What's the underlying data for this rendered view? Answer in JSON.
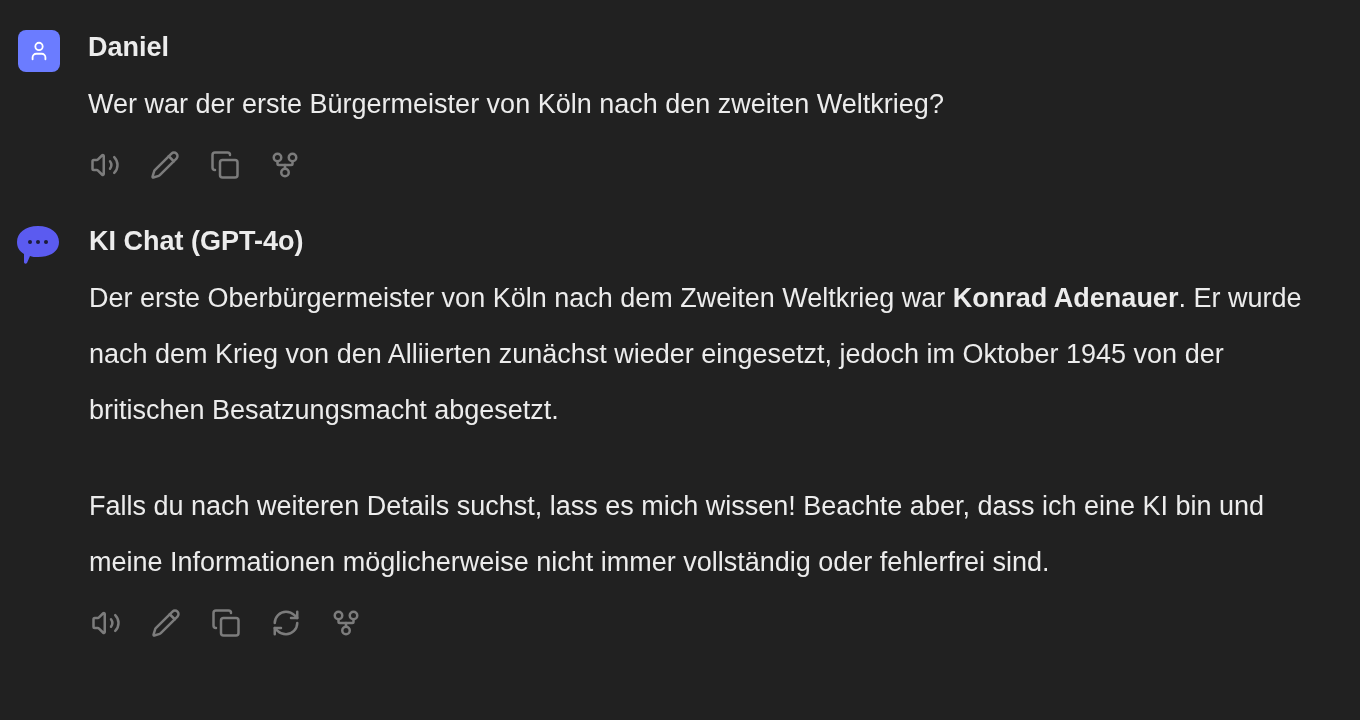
{
  "messages": [
    {
      "sender": "Daniel",
      "avatar": {
        "kind": "user",
        "color": "#6b7cff"
      },
      "paragraphs": [
        "Wer war der erste Bürgermeister von Köln nach den zweiten Weltkrieg?"
      ],
      "actions": [
        {
          "kind": "speak"
        },
        {
          "kind": "edit"
        },
        {
          "kind": "copy"
        },
        {
          "kind": "branch"
        }
      ]
    },
    {
      "sender": "KI Chat (GPT-4o)",
      "avatar": {
        "kind": "bot",
        "color": "#5b5bf0"
      },
      "paragraphs": [
        "Der erste Oberbürgermeister von Köln nach dem Zweiten Weltkrieg war **Konrad Adenauer**. Er wurde nach dem Krieg von den Alliierten zunächst wieder eingesetzt, jedoch im Oktober 1945 von der britischen Besatzungsmacht abgesetzt.",
        "Falls du nach weiteren Details suchst, lass es mich wissen! Beachte aber, dass ich eine KI bin und meine Informationen möglicherweise nicht immer vollständig oder fehlerfrei sind."
      ],
      "actions": [
        {
          "kind": "speak"
        },
        {
          "kind": "edit"
        },
        {
          "kind": "copy"
        },
        {
          "kind": "regenerate"
        },
        {
          "kind": "branch"
        }
      ]
    }
  ]
}
